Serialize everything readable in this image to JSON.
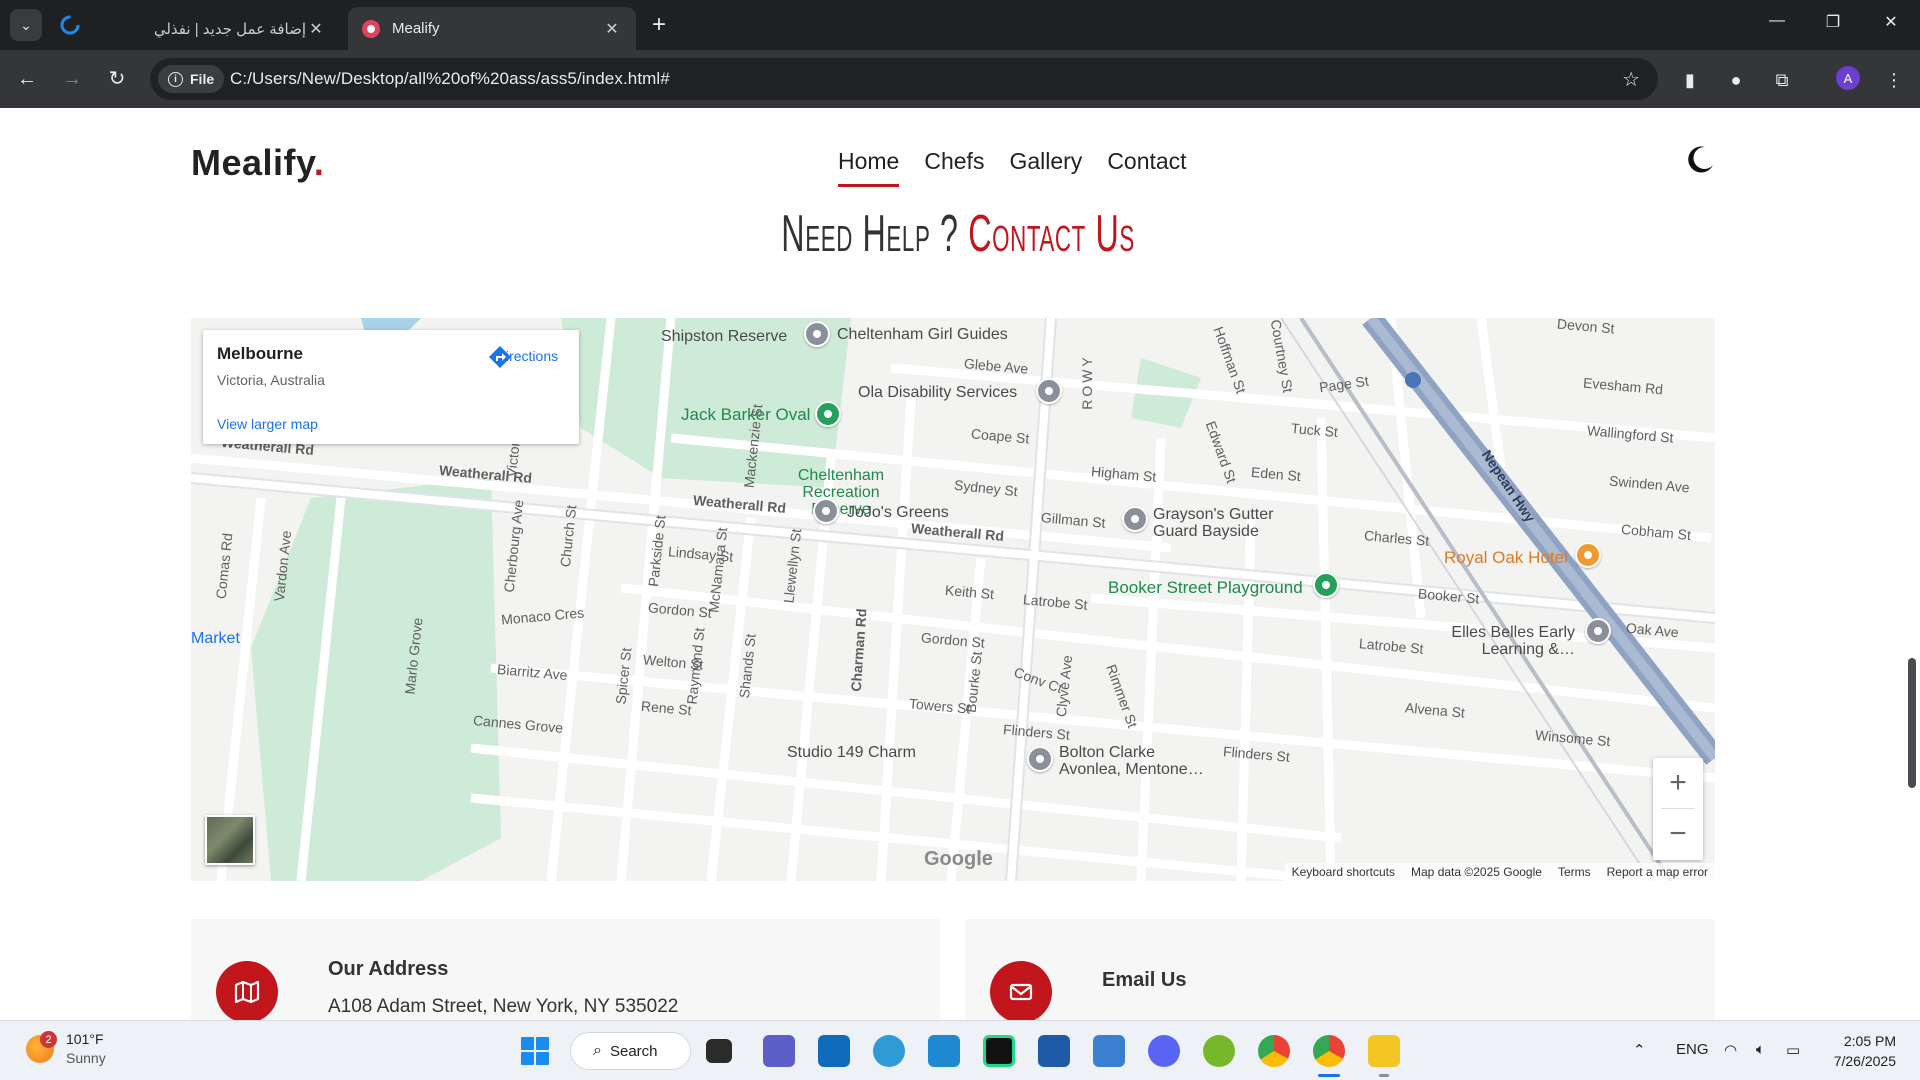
{
  "browser": {
    "tabs": [
      {
        "title": "إضافة عمل جديد | نفذلي",
        "active": false
      },
      {
        "title": "Mealify",
        "active": true
      }
    ],
    "new_tab_label": "+",
    "omnibox_chip": "File",
    "url": "C:/Users/New/Desktop/all%20of%20ass/ass5/index.html#",
    "profile_initial": "A"
  },
  "site": {
    "logo_text": "Mealify",
    "logo_dot": ".",
    "nav": [
      "Home",
      "Chefs",
      "Gallery",
      "Contact"
    ],
    "active_nav": "Home",
    "title_part1": "Need Help ?",
    "title_part2": "Contact Us",
    "accent_color": "#c0161c"
  },
  "map": {
    "card_title": "Melbourne",
    "card_subtitle": "Victoria, Australia",
    "directions_label": "Directions",
    "larger_map_link": "View larger map",
    "zoom_in": "+",
    "zoom_out": "−",
    "google_logo": "Google",
    "attribution": [
      "Keyboard shortcuts",
      "Map data ©2025 Google",
      "Terms",
      "Report a map error"
    ],
    "labels": {
      "cheltenham_girls": "Cheltenham Girl Guides",
      "shipston": "Shipston Reserve",
      "glebe": "Glebe Ave",
      "ola": "Ola Disability Services",
      "jack_barker": "Jack Barker Oval",
      "cheltenham_rec": "Cheltenham Recreation Reserve",
      "coape": "Coape St",
      "higham": "Higham St",
      "sydney": "Sydney St",
      "weatherall1": "Weatherall Rd",
      "weatherall2": "Weatherall Rd",
      "weatherall3": "Weatherall Rd",
      "weatherall4": "Weatherall Rd",
      "jojos": "JoJo's Greens",
      "gillman": "Gillman St",
      "graysons": "Grayson's Gutter Guard Bayside",
      "charles": "Charles St",
      "royal_oak": "Royal Oak Hotel",
      "booker_pg": "Booker Street Playground",
      "booker": "Booker St",
      "lindsay": "Lindsay St",
      "keith": "Keith St",
      "latrobe1": "Latrobe St",
      "latrobe2": "Latrobe St",
      "gordon1": "Gordon St",
      "gordon2": "Gordon St",
      "monaco": "Monaco Cres",
      "welton": "Welton St",
      "biarritz": "Biarritz Ave",
      "rene": "Rene St",
      "towers": "Towers St",
      "cannes": "Cannes Grove",
      "flinders1": "Flinders St",
      "flinders2": "Flinders St",
      "studio": "Studio 149 Charm",
      "bolton": "Bolton Clarke Avonlea, Mentone…",
      "elles": "Elles Belles Early Learning &…",
      "alvena": "Alvena St",
      "winsome": "Winsome St",
      "oak": "Oak Ave",
      "devon": "Devon St",
      "evesham": "Evesham Rd",
      "page": "Page St",
      "tuck": "Tuck St",
      "wallingford": "Wallingford St",
      "swinden": "Swinden Ave",
      "cobham": "Cobham St",
      "eden": "Eden St",
      "nepean": "Nepean Hwy",
      "market": "Market",
      "comas": "Comas Rd",
      "vardon": "Vardon Ave",
      "cherbourg": "Cherbourg Ave",
      "church": "Church St",
      "parkside": "Parkside St",
      "mcnamara": "McNamara St",
      "llewellyn": "Llewellyn St",
      "raymond": "Raymond St",
      "shands": "Shands St",
      "spicer": "Spicer St",
      "charman": "Charman Rd",
      "bourke": "Bourke St",
      "clyve": "Clyve Ave",
      "rimmer": "Rimmer St",
      "edward": "Edward St",
      "hoffman": "Hoffman St",
      "courtney": "Courtney St",
      "victor": "Victor Ave",
      "mackenzie": "Mackenzie St",
      "marlo": "Marlo Grove",
      "conv": "Conv Ct",
      "rowy": "ROWY"
    }
  },
  "contact_cards": [
    {
      "title": "Our Address",
      "line": "A108 Adam Street, New York, NY 535022"
    },
    {
      "title": "Email Us",
      "line": ""
    }
  ],
  "taskbar": {
    "weather_temp": "101°F",
    "weather_cond": "Sunny",
    "weather_badge": "2",
    "search_label": "Search",
    "lang": "ENG",
    "time": "2:05 PM",
    "date": "7/26/2025"
  }
}
